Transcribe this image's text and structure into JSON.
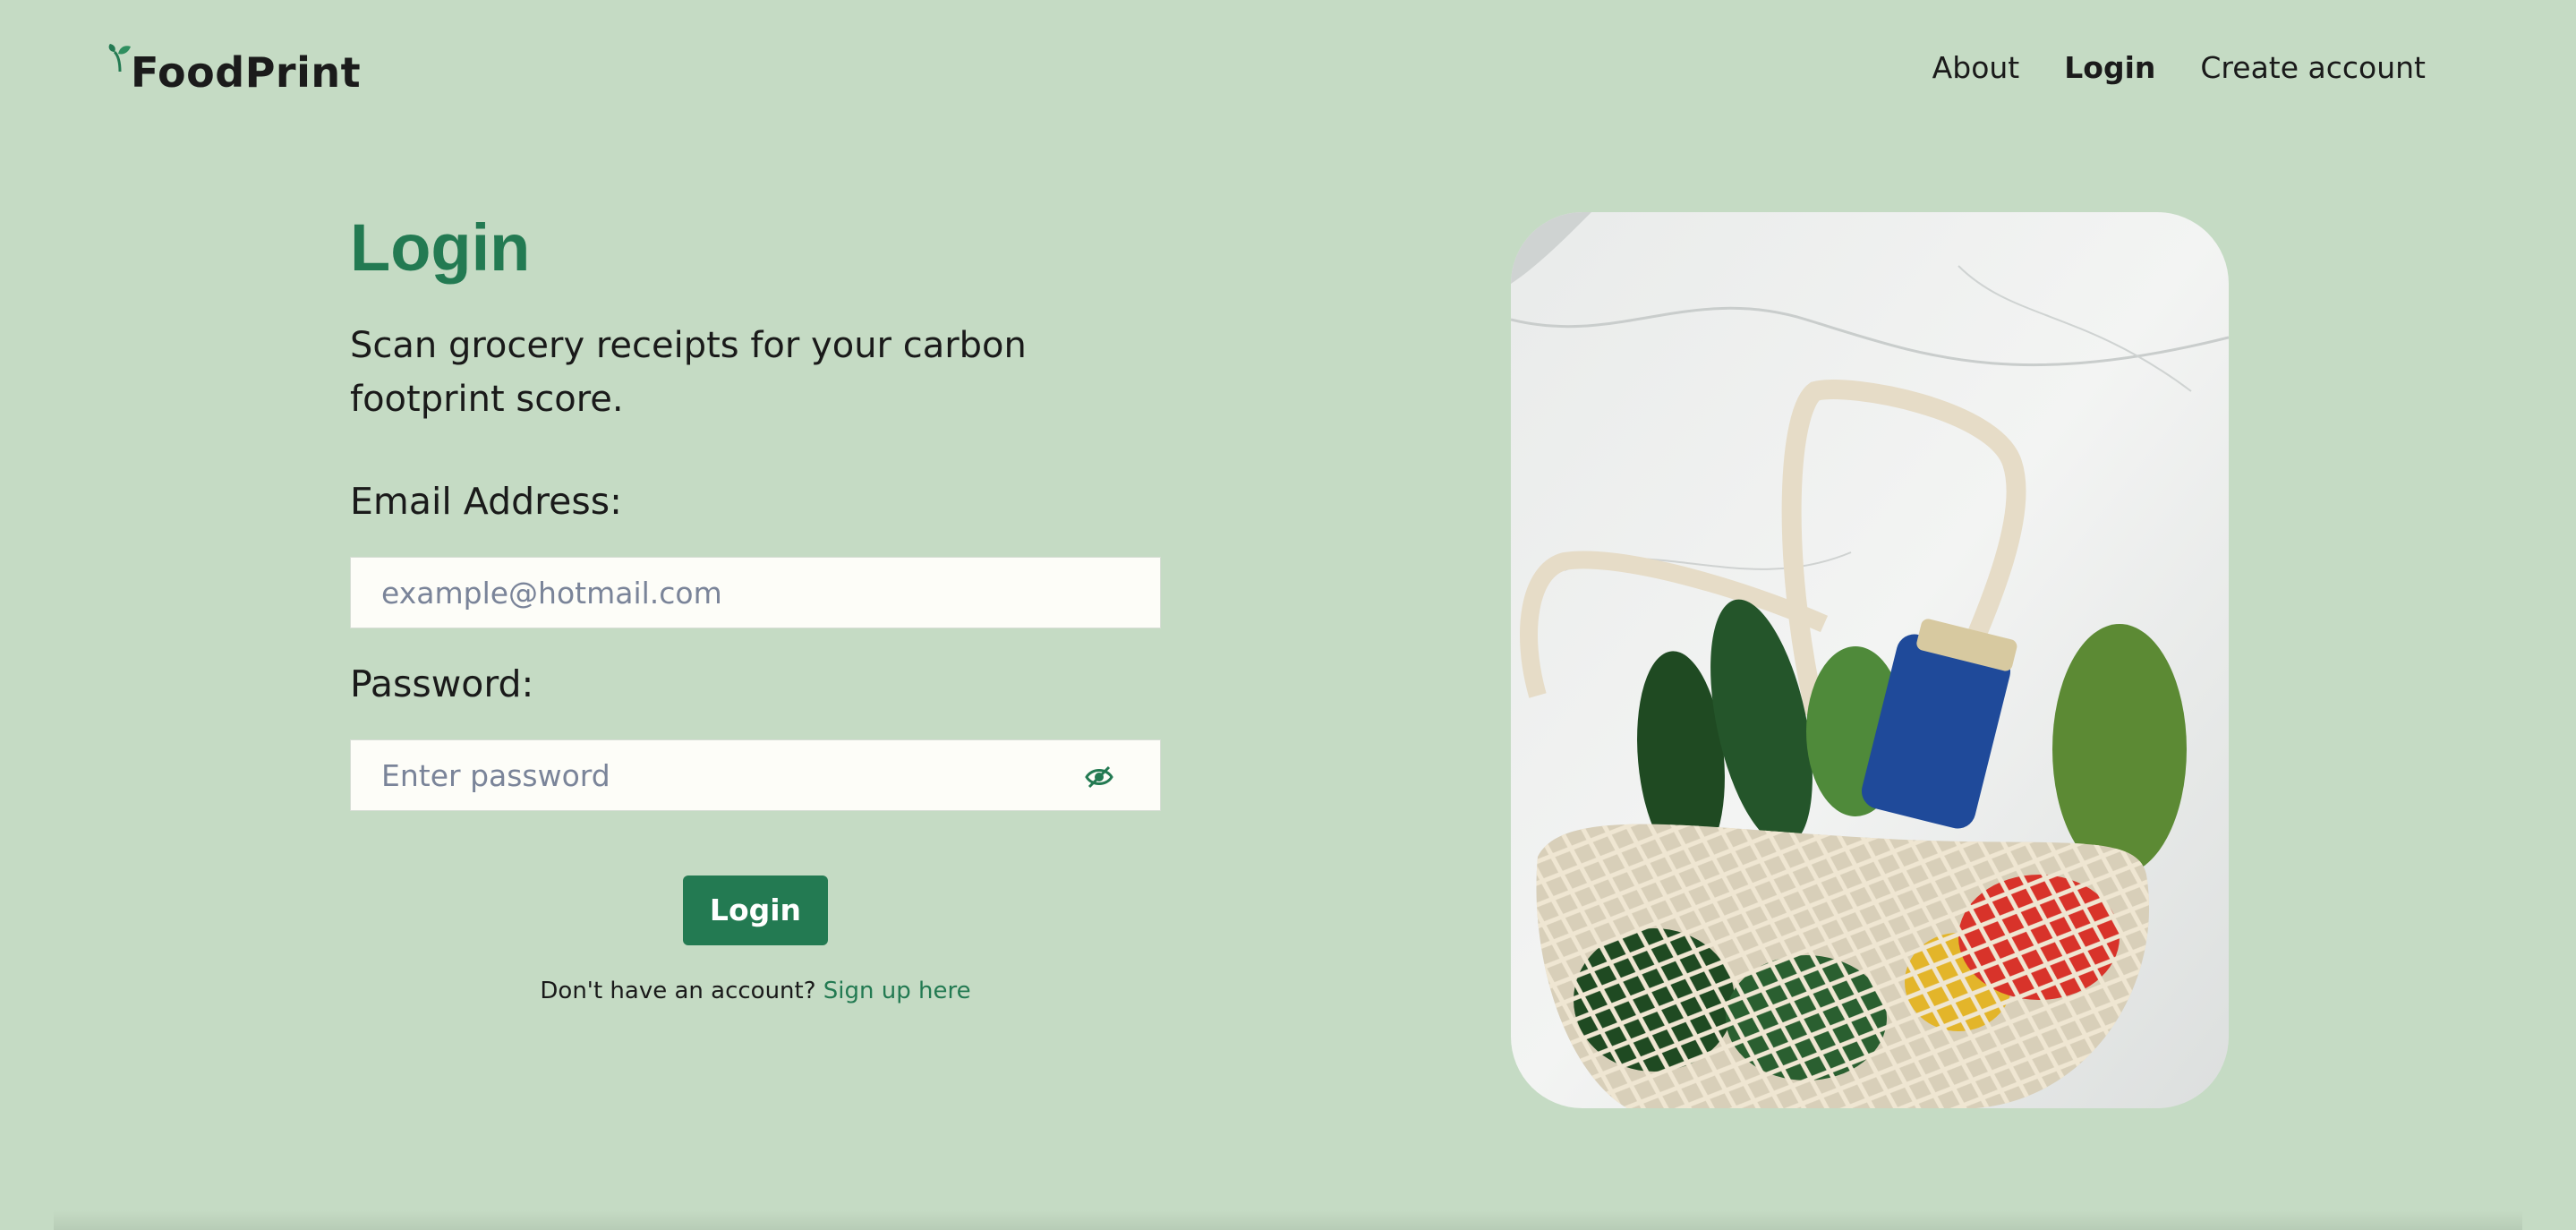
{
  "app": {
    "name": "FoodPrint"
  },
  "nav": {
    "about": "About",
    "login": "Login",
    "create_account": "Create account"
  },
  "main": {
    "title": "Login",
    "subtitle": "Scan grocery receipts for your carbon footprint score.",
    "email_label": "Email Address:",
    "email_placeholder": "example@hotmail.com",
    "password_label": "Password:",
    "password_placeholder": "Enter password",
    "login_button": "Login",
    "signup_prompt": "Don't have an account?",
    "signup_link": "Sign up here"
  },
  "colors": {
    "background": "#c5dbc4",
    "accent": "#237a52",
    "field_bg": "#fdfdf8"
  },
  "icons": {
    "logo": "sprout-icon",
    "password_toggle": "eye-slash-icon"
  }
}
